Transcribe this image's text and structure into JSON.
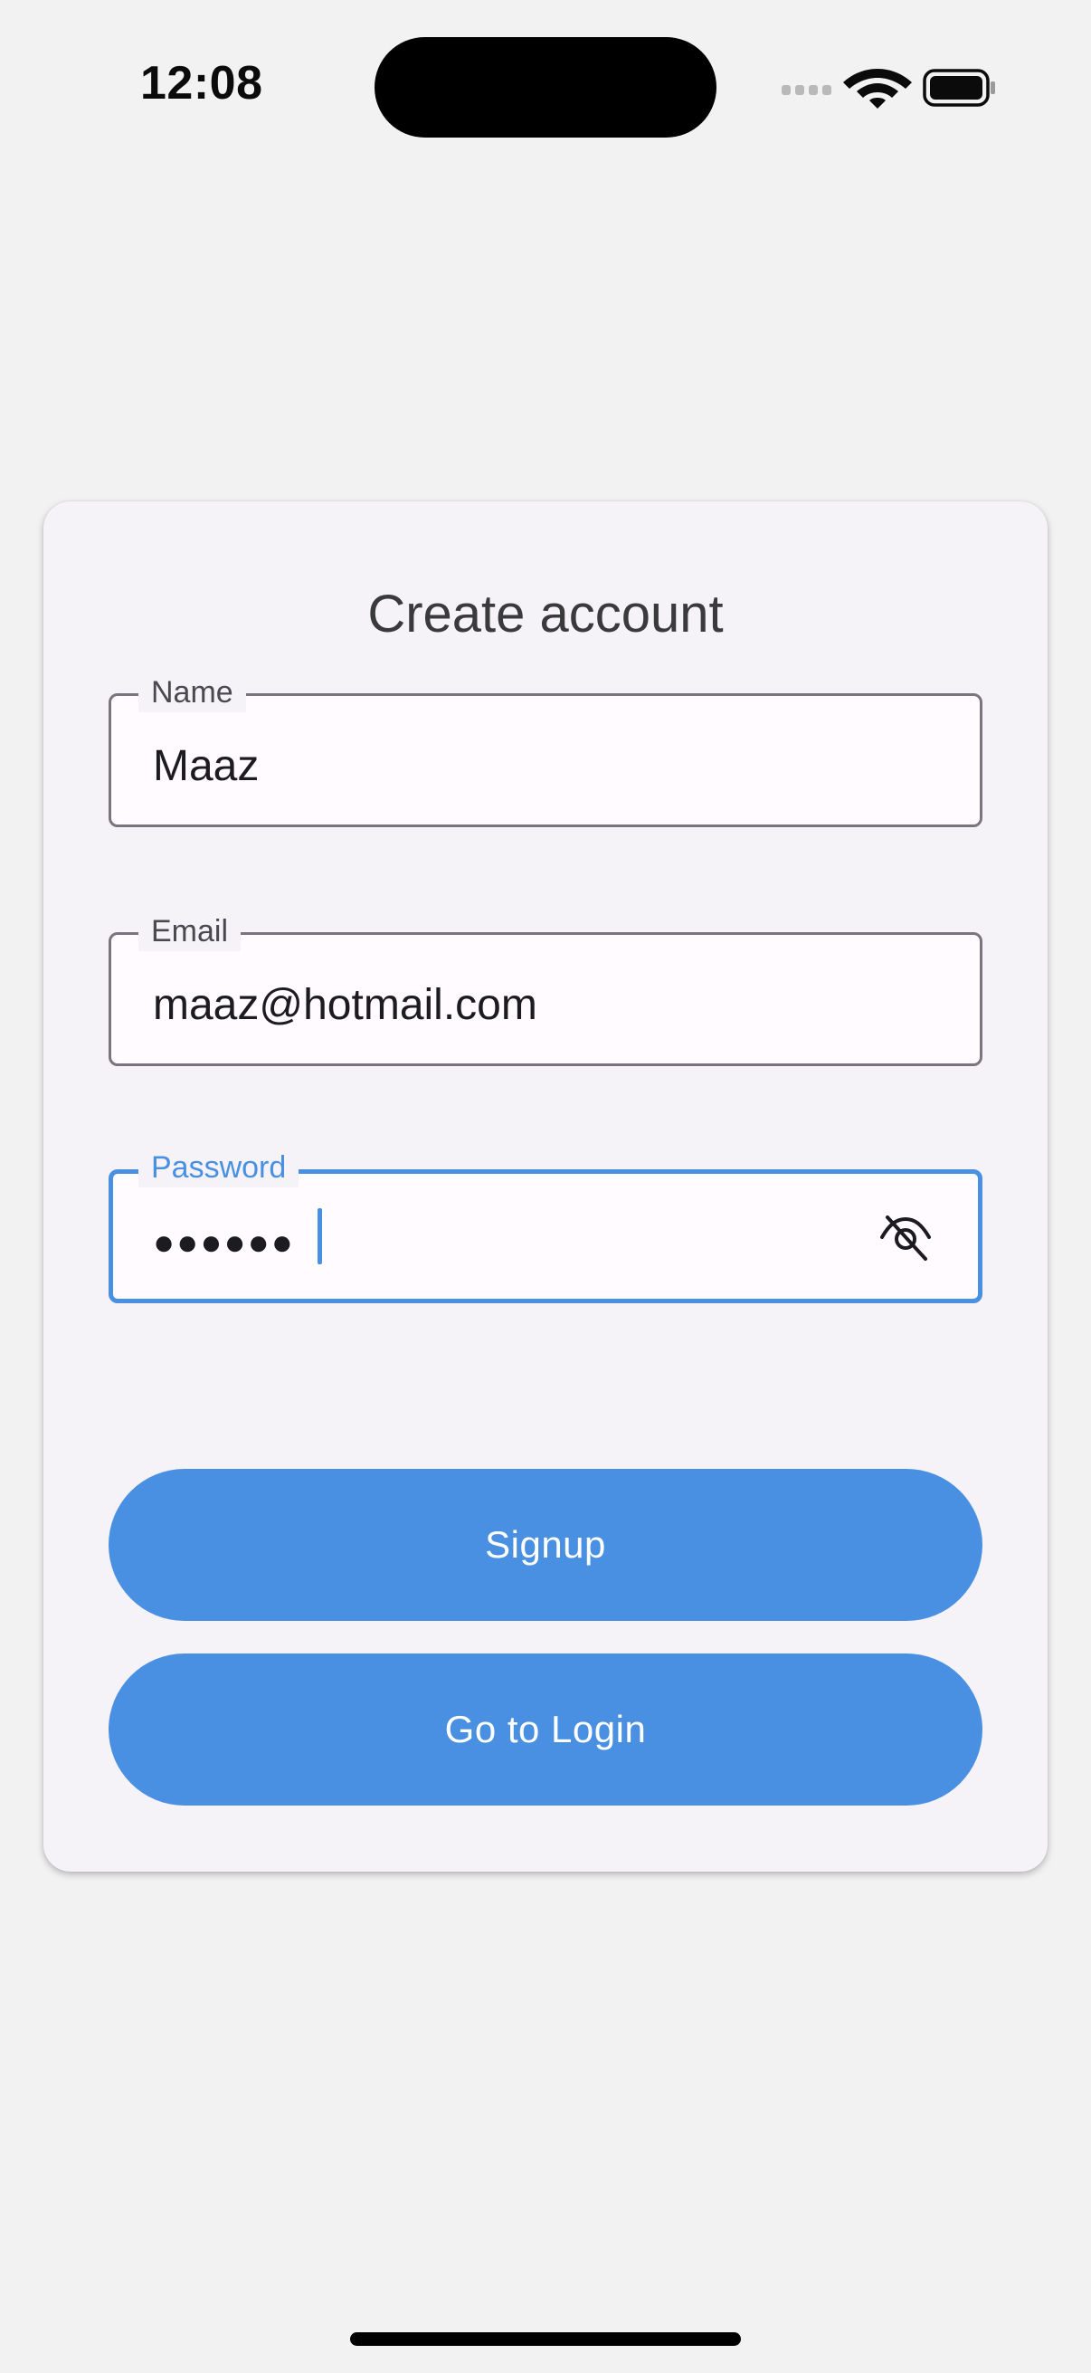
{
  "status_bar": {
    "time": "12:08"
  },
  "form": {
    "title": "Create account",
    "fields": [
      {
        "label": "Name",
        "value": "Maaz"
      },
      {
        "label": "Email",
        "value": "maaz@hotmail.com"
      },
      {
        "label": "Password",
        "value": "●●●●●●"
      }
    ]
  },
  "buttons": {
    "signup": "Signup",
    "go_to_login": "Go to Login"
  },
  "icons": {
    "password_toggle": "eye-off-icon"
  },
  "colors": {
    "accent": "#4a90e2",
    "background": "#f2f2f2",
    "card": "#f5f3f7"
  }
}
